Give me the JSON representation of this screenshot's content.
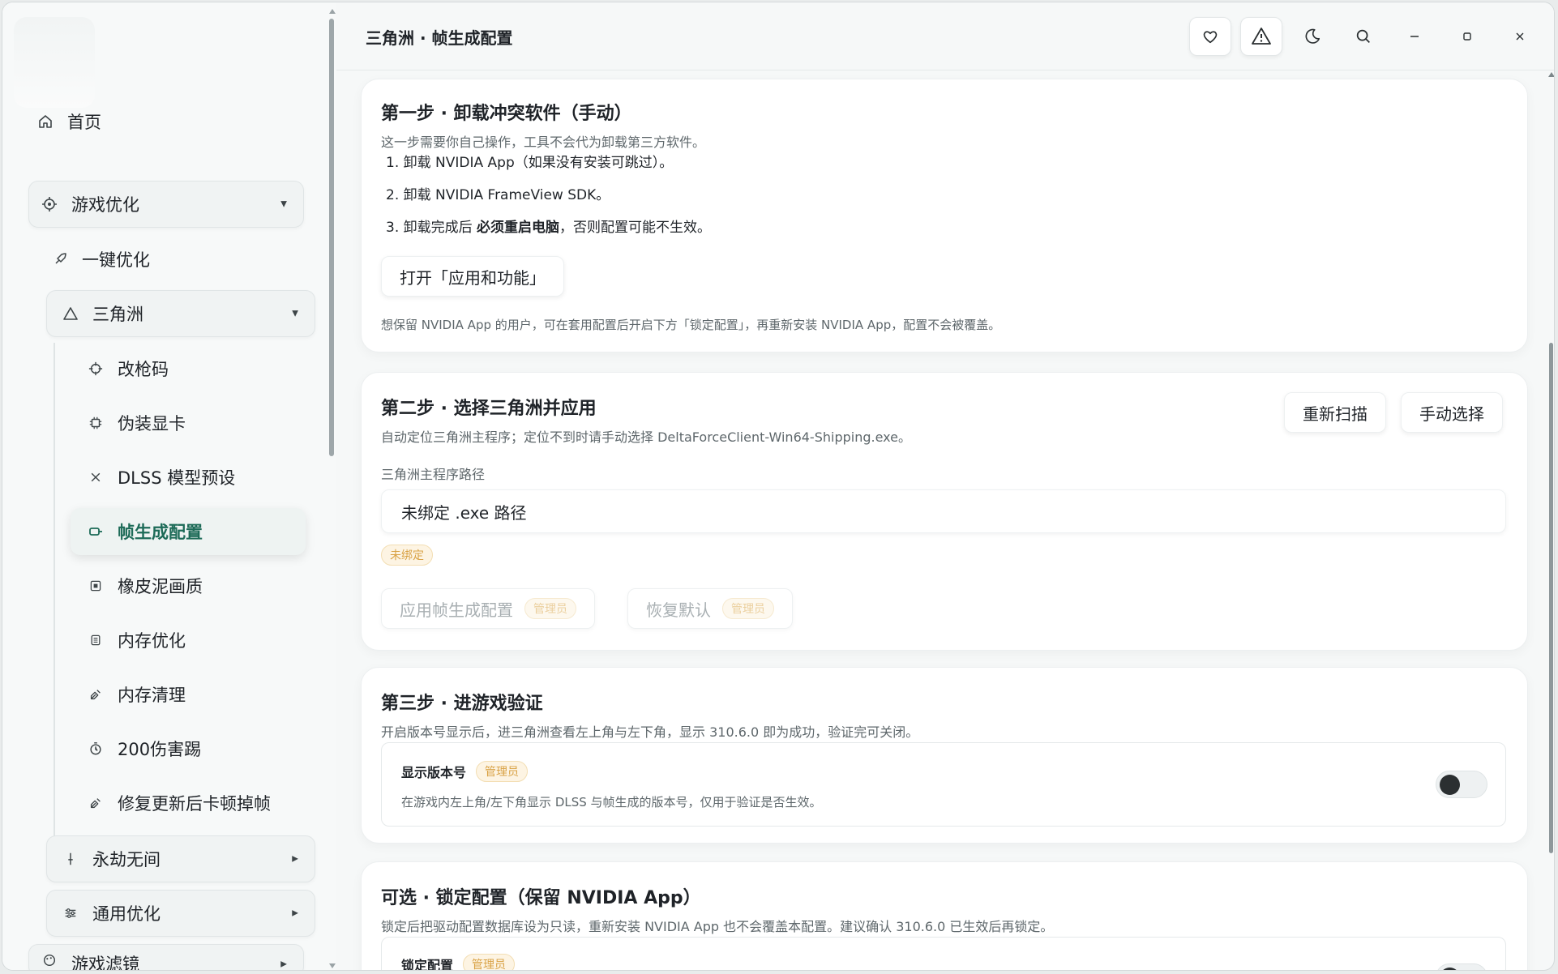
{
  "header": {
    "title": "三角洲 · 帧生成配置",
    "icons": [
      "heart-icon",
      "warning-icon",
      "moon-icon",
      "search-icon",
      "minimize-icon",
      "maximize-icon",
      "close-icon"
    ]
  },
  "sidebar": {
    "home": "首页",
    "game_opt": "游戏优化",
    "one_click": "一键优化",
    "delta": "三角洲",
    "sub_items": [
      "改枪码",
      "伪装显卡",
      "DLSS 模型预设",
      "帧生成配置",
      "橡皮泥画质",
      "内存优化",
      "内存清理",
      "200伤害踢",
      "修复更新后卡顿掉帧"
    ],
    "active": "帧生成配置",
    "naraka": "永劫无间",
    "general": "通用优化",
    "filters": "游戏滤镜"
  },
  "step1": {
    "title": "第一步 · 卸载冲突软件（手动）",
    "desc": "这一步需要你自己操作，工具不会代为卸载第三方软件。",
    "item1": "1. 卸载 NVIDIA App（如果没有安装可跳过）。",
    "item2": "2. 卸载 NVIDIA FrameView SDK。",
    "item3_pre": "3. 卸载完成后 ",
    "item3_bold": "必须重启电脑",
    "item3_post": "，否则配置可能不生效。",
    "button": "打开「应用和功能」",
    "note": "想保留 NVIDIA App 的用户，可在套用配置后开启下方「锁定配置」，再重新安装 NVIDIA App，配置不会被覆盖。"
  },
  "step2": {
    "title": "第二步 · 选择三角洲并应用",
    "desc": "自动定位三角洲主程序；定位不到时请手动选择 DeltaForceClient-Win64-Shipping.exe。",
    "rescan": "重新扫描",
    "manual": "手动选择",
    "path_label": "三角洲主程序路径",
    "path_value": "未绑定 .exe 路径",
    "status_tag": "未绑定",
    "apply": "应用帧生成配置",
    "restore": "恢复默认",
    "admin_tag": "管理员"
  },
  "step3": {
    "title": "第三步 · 进游戏验证",
    "desc": "开启版本号显示后，进三角洲查看左上角与左下角，显示 310.6.0 即为成功，验证完可关闭。",
    "option_title": "显示版本号",
    "option_tag": "管理员",
    "option_desc": "在游戏内左上角/左下角显示 DLSS 与帧生成的版本号，仅用于验证是否生效。",
    "toggle_on": false
  },
  "optional": {
    "title": "可选 · 锁定配置（保留 NVIDIA App）",
    "desc": "锁定后把驱动配置数据库设为只读，重新安装 NVIDIA App 也不会覆盖本配置。建议确认 310.6.0 已生效后再锁定。",
    "option_title": "锁定配置",
    "option_tag": "管理员",
    "toggle_on": false
  }
}
